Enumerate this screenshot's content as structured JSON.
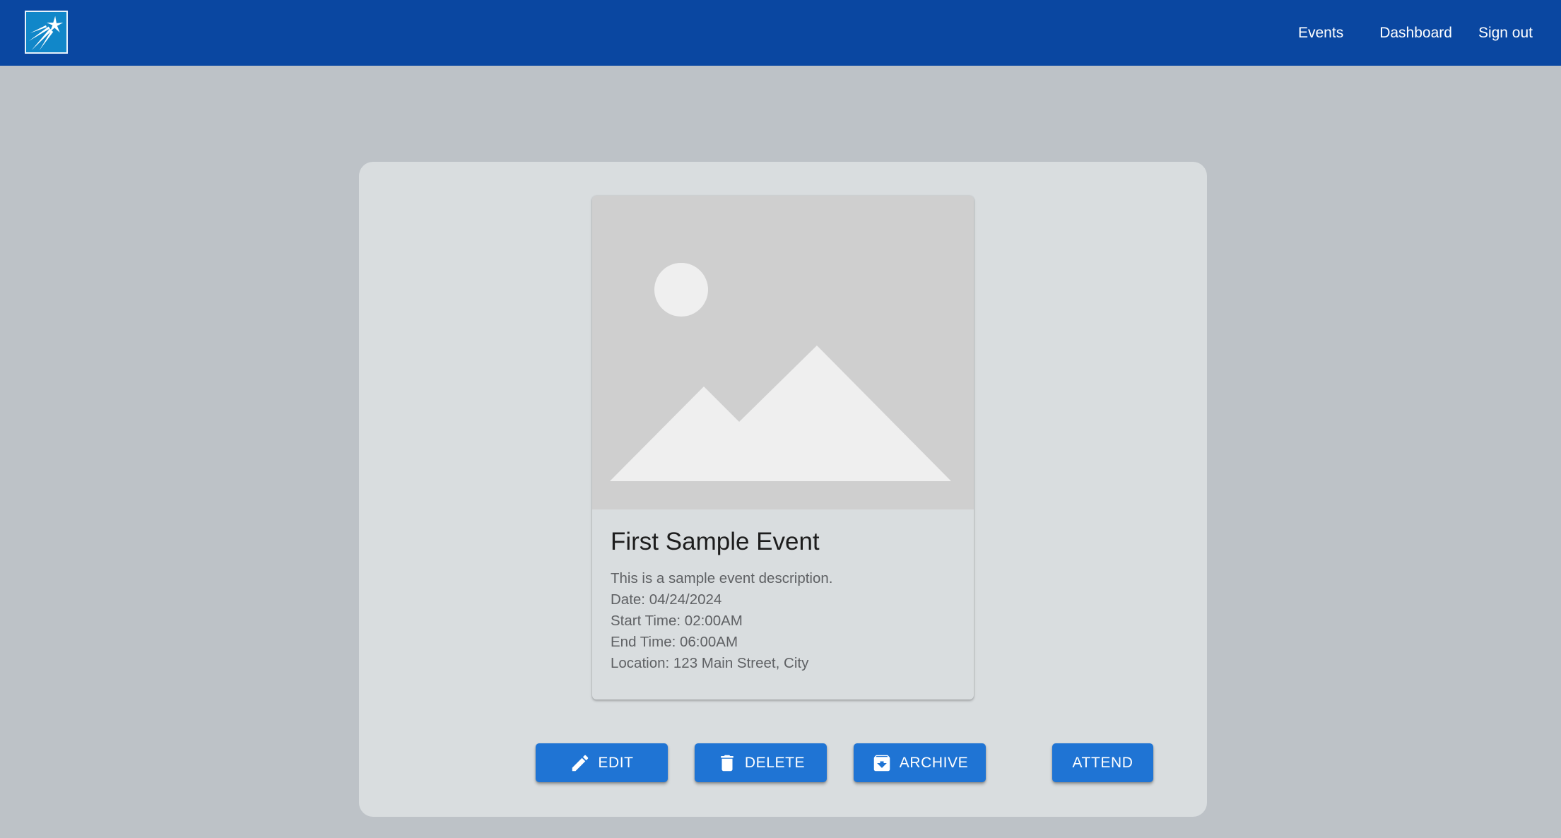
{
  "colors": {
    "navbar": "#0a47a1",
    "page_background": "#bdc2c7",
    "panel_background": "#d9dddf",
    "button": "#1f74d4",
    "image_placeholder": "#cfcfcf"
  },
  "header": {
    "logo_icon": "shooting-star-logo",
    "nav": {
      "events": "Events",
      "dashboard": "Dashboard",
      "sign_out": "Sign out"
    }
  },
  "event_card": {
    "image_icon": "image-placeholder-icon",
    "title": "First Sample Event",
    "description": "This is a sample event description.",
    "date": "Date: 04/24/2024",
    "start_time": "Start Time: 02:00AM",
    "end_time": "End Time: 06:00AM",
    "location": "Location: 123 Main Street, City"
  },
  "actions": {
    "edit": {
      "label": "EDIT",
      "icon": "pencil-icon"
    },
    "delete": {
      "label": "DELETE",
      "icon": "trash-icon"
    },
    "archive": {
      "label": "ARCHIVE",
      "icon": "archive-icon"
    },
    "attend": {
      "label": "ATTEND"
    }
  }
}
